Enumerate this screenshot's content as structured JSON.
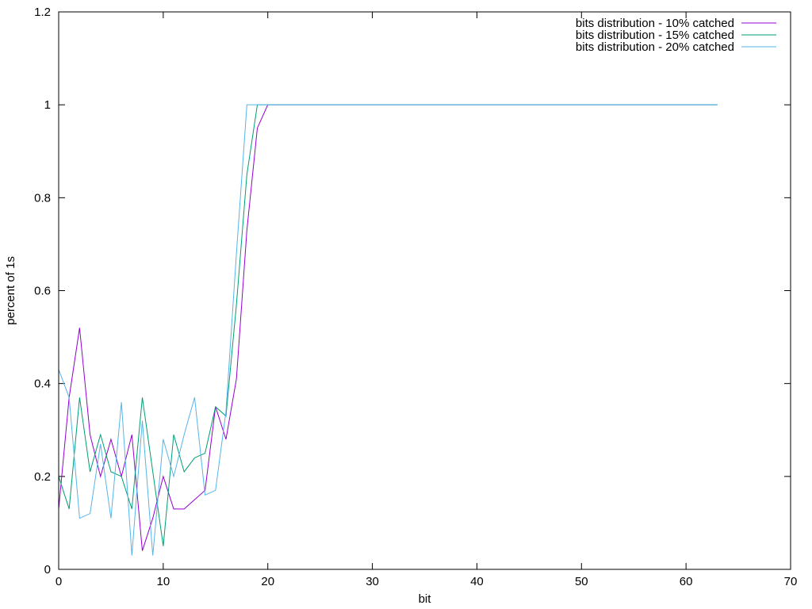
{
  "chart_data": {
    "type": "line",
    "title": "",
    "xlabel": "bit",
    "ylabel": "percent of 1s",
    "xlim": [
      0,
      70
    ],
    "ylim": [
      0,
      1.2
    ],
    "x_ticks": [
      0,
      10,
      20,
      30,
      40,
      50,
      60,
      70
    ],
    "y_ticks": [
      0,
      0.2,
      0.4,
      0.6,
      0.8,
      1,
      1.2
    ],
    "x_tick_labels": [
      "0",
      "10",
      "20",
      "30",
      "40",
      "50",
      "60",
      "70"
    ],
    "y_tick_labels": [
      "0",
      "0.2",
      "0.4",
      "0.6",
      "0.8",
      "1",
      "1.2"
    ],
    "grid": false,
    "legend_position": "top-right",
    "series": [
      {
        "name": "bits distribution - 10% catched",
        "color": "#9400d3",
        "x": [
          0,
          1,
          2,
          3,
          4,
          5,
          6,
          7,
          8,
          9,
          10,
          11,
          12,
          13,
          14,
          15,
          16,
          17,
          18,
          19,
          20,
          21,
          22,
          23,
          24,
          25,
          26,
          27,
          28,
          29,
          30,
          31,
          32,
          33,
          34,
          35,
          36,
          37,
          38,
          39,
          40,
          41,
          42,
          43,
          44,
          45,
          46,
          47,
          48,
          49,
          50,
          51,
          52,
          53,
          54,
          55,
          56,
          57,
          58,
          59,
          60,
          61,
          62,
          63
        ],
        "y": [
          0.13,
          0.37,
          0.52,
          0.29,
          0.2,
          0.28,
          0.2,
          0.29,
          0.04,
          0.11,
          0.2,
          0.13,
          0.13,
          0.15,
          0.17,
          0.35,
          0.28,
          0.41,
          0.73,
          0.95,
          1,
          1,
          1,
          1,
          1,
          1,
          1,
          1,
          1,
          1,
          1,
          1,
          1,
          1,
          1,
          1,
          1,
          1,
          1,
          1,
          1,
          1,
          1,
          1,
          1,
          1,
          1,
          1,
          1,
          1,
          1,
          1,
          1,
          1,
          1,
          1,
          1,
          1,
          1,
          1,
          1,
          1,
          1,
          1
        ]
      },
      {
        "name": "bits distribution - 15% catched",
        "color": "#009e73",
        "x": [
          0,
          1,
          2,
          3,
          4,
          5,
          6,
          7,
          8,
          9,
          10,
          11,
          12,
          13,
          14,
          15,
          16,
          17,
          18,
          19,
          20,
          21,
          22,
          23,
          24,
          25,
          26,
          27,
          28,
          29,
          30,
          31,
          32,
          33,
          34,
          35,
          36,
          37,
          38,
          39,
          40,
          41,
          42,
          43,
          44,
          45,
          46,
          47,
          48,
          49,
          50,
          51,
          52,
          53,
          54,
          55,
          56,
          57,
          58,
          59,
          60,
          61,
          62,
          63
        ],
        "y": [
          0.2,
          0.13,
          0.37,
          0.21,
          0.29,
          0.21,
          0.2,
          0.13,
          0.37,
          0.21,
          0.05,
          0.29,
          0.21,
          0.24,
          0.25,
          0.35,
          0.33,
          0.57,
          0.85,
          1,
          1,
          1,
          1,
          1,
          1,
          1,
          1,
          1,
          1,
          1,
          1,
          1,
          1,
          1,
          1,
          1,
          1,
          1,
          1,
          1,
          1,
          1,
          1,
          1,
          1,
          1,
          1,
          1,
          1,
          1,
          1,
          1,
          1,
          1,
          1,
          1,
          1,
          1,
          1,
          1,
          1,
          1,
          1,
          1
        ]
      },
      {
        "name": "bits distribution - 20% catched",
        "color": "#56b4e9",
        "x": [
          0,
          1,
          2,
          3,
          4,
          5,
          6,
          7,
          8,
          9,
          10,
          11,
          12,
          13,
          14,
          15,
          16,
          17,
          18,
          19,
          20,
          21,
          22,
          23,
          24,
          25,
          26,
          27,
          28,
          29,
          30,
          31,
          32,
          33,
          34,
          35,
          36,
          37,
          38,
          39,
          40,
          41,
          42,
          43,
          44,
          45,
          46,
          47,
          48,
          49,
          50,
          51,
          52,
          53,
          54,
          55,
          56,
          57,
          58,
          59,
          60,
          61,
          62,
          63
        ],
        "y": [
          0.43,
          0.37,
          0.11,
          0.12,
          0.27,
          0.11,
          0.36,
          0.03,
          0.32,
          0.03,
          0.28,
          0.2,
          0.29,
          0.37,
          0.16,
          0.17,
          0.34,
          0.68,
          1,
          1,
          1,
          1,
          1,
          1,
          1,
          1,
          1,
          1,
          1,
          1,
          1,
          1,
          1,
          1,
          1,
          1,
          1,
          1,
          1,
          1,
          1,
          1,
          1,
          1,
          1,
          1,
          1,
          1,
          1,
          1,
          1,
          1,
          1,
          1,
          1,
          1,
          1,
          1,
          1,
          1,
          1,
          1,
          1,
          1
        ]
      }
    ]
  }
}
